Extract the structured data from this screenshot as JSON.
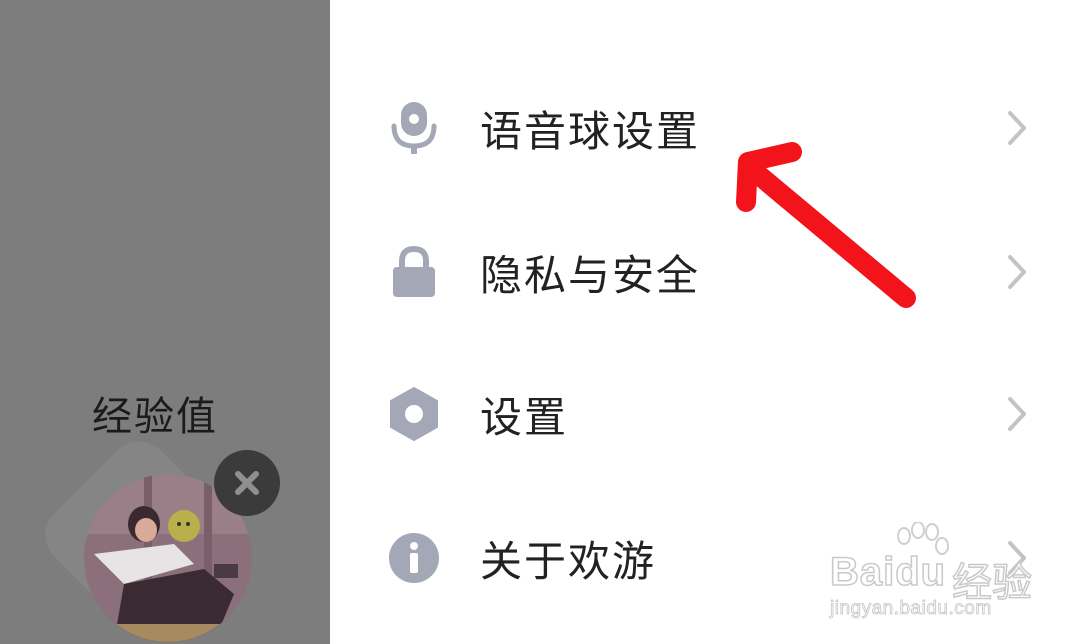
{
  "left_panel": {
    "exp_label": "经验值"
  },
  "menu": {
    "items": [
      {
        "label": "语音球设置",
        "icon": "microphone-icon"
      },
      {
        "label": "隐私与安全",
        "icon": "lock-icon"
      },
      {
        "label": "设置",
        "icon": "hexagon-gear-icon"
      },
      {
        "label": "关于欢游",
        "icon": "info-icon"
      }
    ]
  },
  "colors": {
    "icon": "#a3a7b6",
    "chevron": "#c4c4c4",
    "arrow": "#f2141a",
    "dim_overlay": "#7d7d7d"
  },
  "watermark": {
    "brand": "Bai",
    "brand_suffix": "du",
    "brand_cn": "经验",
    "url": "jingyan.baidu.com"
  }
}
